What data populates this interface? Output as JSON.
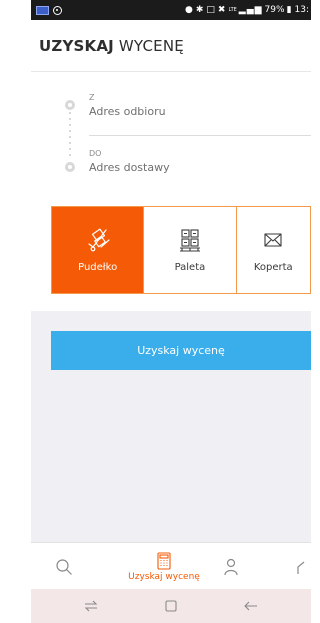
{
  "status_bar": {
    "battery": "79%",
    "time": "13:",
    "network": "LTE"
  },
  "header": {
    "title_bold": "UZYSKAJ",
    "title_rest": " WYCENĘ"
  },
  "address": {
    "from_label": "Z",
    "from_value": "Adres odbioru",
    "to_label": "DO",
    "to_value": "Adres dostawy"
  },
  "package_types": [
    {
      "label": "Pudełko",
      "icon": "handtruck-box-icon",
      "selected": true
    },
    {
      "label": "Paleta",
      "icon": "pallet-icon",
      "selected": false
    },
    {
      "label": "Koperta",
      "icon": "envelope-icon",
      "selected": false
    }
  ],
  "cta": {
    "label": "Uzyskaj wycenę"
  },
  "bottom_nav": {
    "search_icon": "search-icon",
    "quote_label": "Uzyskaj wycenę",
    "quote_icon": "calculator-icon",
    "user_icon": "user-icon"
  },
  "colors": {
    "accent": "#f55a06",
    "cta": "#3aaeea",
    "background_grey": "#efeff4"
  }
}
